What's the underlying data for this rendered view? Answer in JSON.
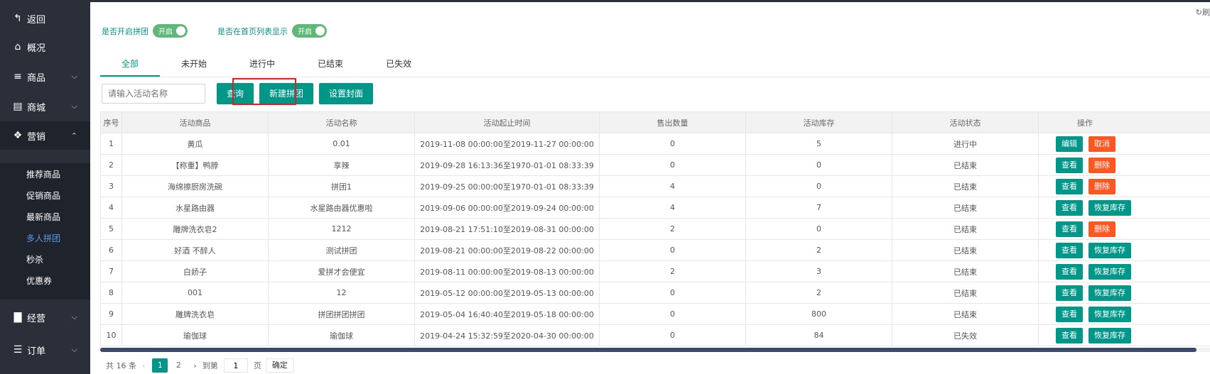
{
  "sidebar": {
    "back": {
      "label": "返回",
      "icon": "back-arrow-icon"
    },
    "items": [
      {
        "label": "概况",
        "icon": "home-icon"
      },
      {
        "label": "商品",
        "icon": "menu-icon"
      },
      {
        "label": "商城",
        "icon": "shop-icon"
      },
      {
        "label": "营销",
        "icon": "gift-icon"
      }
    ],
    "marketing_sub": [
      {
        "label": "推荐商品"
      },
      {
        "label": "促销商品"
      },
      {
        "label": "最新商品"
      },
      {
        "label": "多人拼团"
      },
      {
        "label": "秒杀"
      },
      {
        "label": "优惠券"
      }
    ],
    "bottom_items": [
      {
        "label": "经营",
        "icon": "bar-chart-icon"
      },
      {
        "label": "订单",
        "icon": "list-icon"
      }
    ]
  },
  "header": {
    "refresh_label": "刷"
  },
  "toggles": [
    {
      "label": "是否开启拼团",
      "switch_text": "开启"
    },
    {
      "label": "是否在首页列表显示",
      "switch_text": "开启"
    }
  ],
  "tabs": [
    "全部",
    "未开始",
    "进行中",
    "已结束",
    "已失效"
  ],
  "toolbar": {
    "search_placeholder": "请输入活动名称",
    "query_label": "查询",
    "new_group_label": "新建拼团",
    "set_cover_label": "设置封面"
  },
  "table": {
    "columns": [
      "序号",
      "活动商品",
      "活动名称",
      "活动起止时间",
      "售出数量",
      "活动库存",
      "活动状态",
      "操作"
    ],
    "rows": [
      {
        "no": "1",
        "product": "黄瓜",
        "name": "0.01",
        "time": "2019-11-08 00:00:00至2019-11-27 00:00:00",
        "sold": "0",
        "stock": "5",
        "status": "进行中",
        "ops": [
          {
            "label": "编辑",
            "color": "green"
          },
          {
            "label": "取消",
            "color": "orange"
          }
        ]
      },
      {
        "no": "2",
        "product": "【称重】鸭脖",
        "name": "享辣",
        "time": "2019-09-28 16:13:36至1970-01-01 08:33:39",
        "sold": "0",
        "stock": "0",
        "status": "已结束",
        "ops": [
          {
            "label": "查看",
            "color": "green"
          },
          {
            "label": "删除",
            "color": "orange"
          }
        ]
      },
      {
        "no": "3",
        "product": "海绵擦厨房洗碗",
        "name": "拼团1",
        "time": "2019-09-25 00:00:00至1970-01-01 08:33:39",
        "sold": "4",
        "stock": "0",
        "status": "已结束",
        "ops": [
          {
            "label": "查看",
            "color": "green"
          },
          {
            "label": "删除",
            "color": "orange"
          }
        ]
      },
      {
        "no": "4",
        "product": "水星路由器",
        "name": "水星路由器优惠啦",
        "time": "2019-09-06 00:00:00至2019-09-24 00:00:00",
        "sold": "4",
        "stock": "7",
        "status": "已结束",
        "ops": [
          {
            "label": "查看",
            "color": "green"
          },
          {
            "label": "恢复库存",
            "color": "green"
          }
        ]
      },
      {
        "no": "5",
        "product": "雕牌洗衣皂2",
        "name": "1212",
        "time": "2019-08-21 17:51:10至2019-08-31 00:00:00",
        "sold": "2",
        "stock": "0",
        "status": "已结束",
        "ops": [
          {
            "label": "查看",
            "color": "green"
          },
          {
            "label": "删除",
            "color": "orange"
          }
        ]
      },
      {
        "no": "6",
        "product": "好酒 不醉人",
        "name": "测试拼团",
        "time": "2019-08-21 00:00:00至2019-08-22 00:00:00",
        "sold": "0",
        "stock": "2",
        "status": "已结束",
        "ops": [
          {
            "label": "查看",
            "color": "green"
          },
          {
            "label": "恢复库存",
            "color": "green"
          }
        ]
      },
      {
        "no": "7",
        "product": "白娇子",
        "name": "爱拼才会便宜",
        "time": "2019-08-11 00:00:00至2019-08-13 00:00:00",
        "sold": "2",
        "stock": "3",
        "status": "已结束",
        "ops": [
          {
            "label": "查看",
            "color": "green"
          },
          {
            "label": "恢复库存",
            "color": "green"
          }
        ]
      },
      {
        "no": "8",
        "product": "001",
        "name": "12",
        "time": "2019-05-12 00:00:00至2019-05-13 00:00:00",
        "sold": "0",
        "stock": "2",
        "status": "已结束",
        "ops": [
          {
            "label": "查看",
            "color": "green"
          },
          {
            "label": "恢复库存",
            "color": "green"
          }
        ]
      },
      {
        "no": "9",
        "product": "雕牌洗衣皂",
        "name": "拼团拼团拼团",
        "time": "2019-05-04 16:40:40至2019-05-18 00:00:00",
        "sold": "0",
        "stock": "800",
        "status": "已结束",
        "ops": [
          {
            "label": "查看",
            "color": "green"
          },
          {
            "label": "恢复库存",
            "color": "green"
          }
        ]
      },
      {
        "no": "10",
        "product": "瑜伽球",
        "name": "瑜伽球",
        "time": "2019-04-24 15:32:59至2020-04-30 00:00:00",
        "sold": "0",
        "stock": "84",
        "status": "已失效",
        "ops": [
          {
            "label": "查看",
            "color": "green"
          },
          {
            "label": "恢复库存",
            "color": "green"
          }
        ]
      }
    ]
  },
  "pagination": {
    "total_label": "共 16 条",
    "pages": [
      "1",
      "2"
    ],
    "current_page": "1",
    "goto_label": "到第",
    "goto_value": "1",
    "page_suffix": "页",
    "confirm_label": "确定"
  },
  "colors": {
    "sidebar_bg": "#2a2f3a",
    "accent": "#009688",
    "danger": "#ff5722",
    "highlight": "#e0201f"
  }
}
